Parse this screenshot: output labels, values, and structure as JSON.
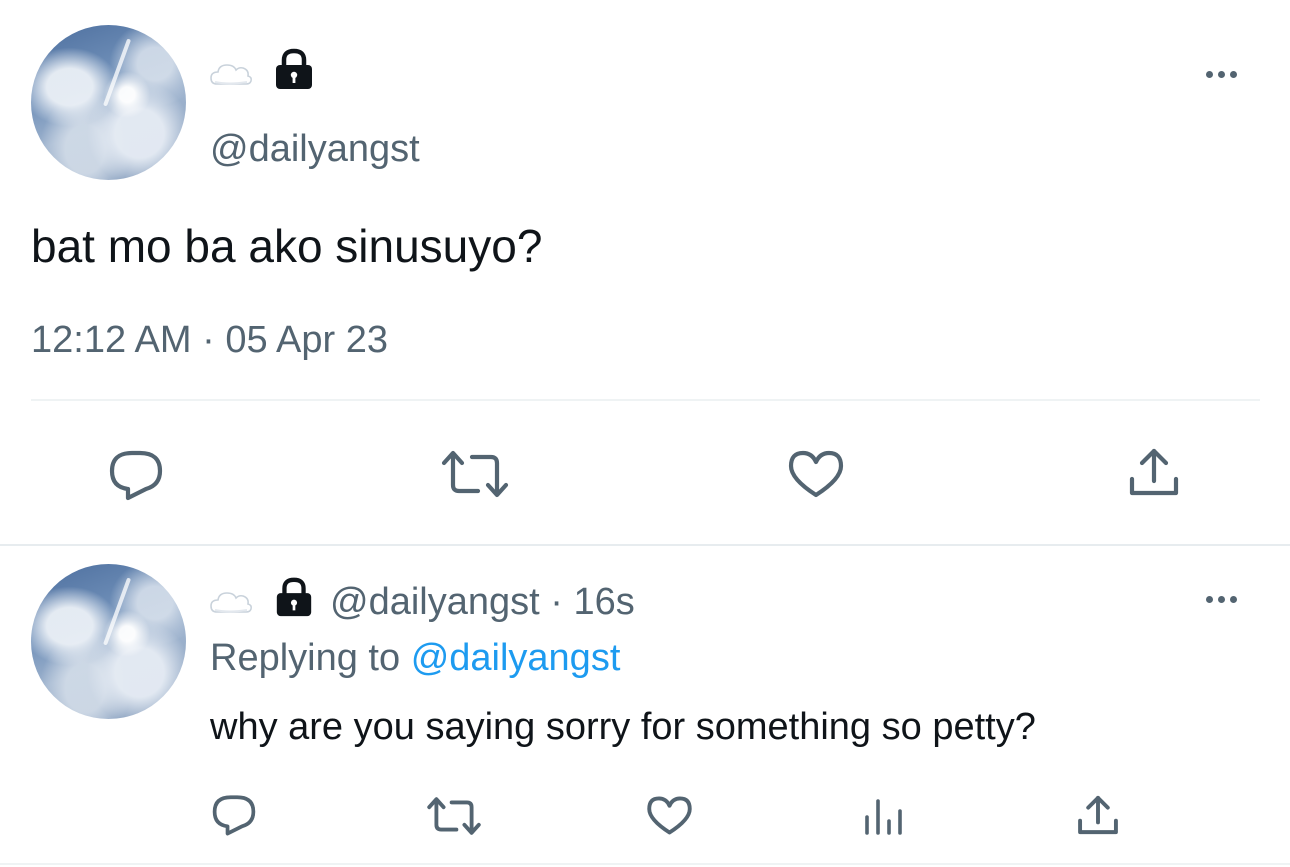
{
  "tweet": {
    "display_name_emoji": "cloud-emoji",
    "protected_icon": "lock-icon",
    "handle": "@dailyangst",
    "text": "bat mo ba ako sinusuyo?",
    "timestamp": "12:12 AM · 05 Apr 23",
    "actions": [
      "reply-icon",
      "retweet-icon",
      "like-icon",
      "share-icon"
    ]
  },
  "reply": {
    "display_name_emoji": "cloud-emoji",
    "protected_icon": "lock-icon",
    "handle": "@dailyangst",
    "time": "· 16s",
    "replying_prefix": "Replying to",
    "replying_to": "@dailyangst",
    "text": "why are you saying sorry for something so petty?",
    "actions": [
      "reply-icon",
      "retweet-icon",
      "like-icon",
      "analytics-icon",
      "share-icon"
    ]
  },
  "colors": {
    "text": "#0f1419",
    "muted": "#536471",
    "link": "#1d9bf0",
    "divider": "#eff3f4"
  }
}
